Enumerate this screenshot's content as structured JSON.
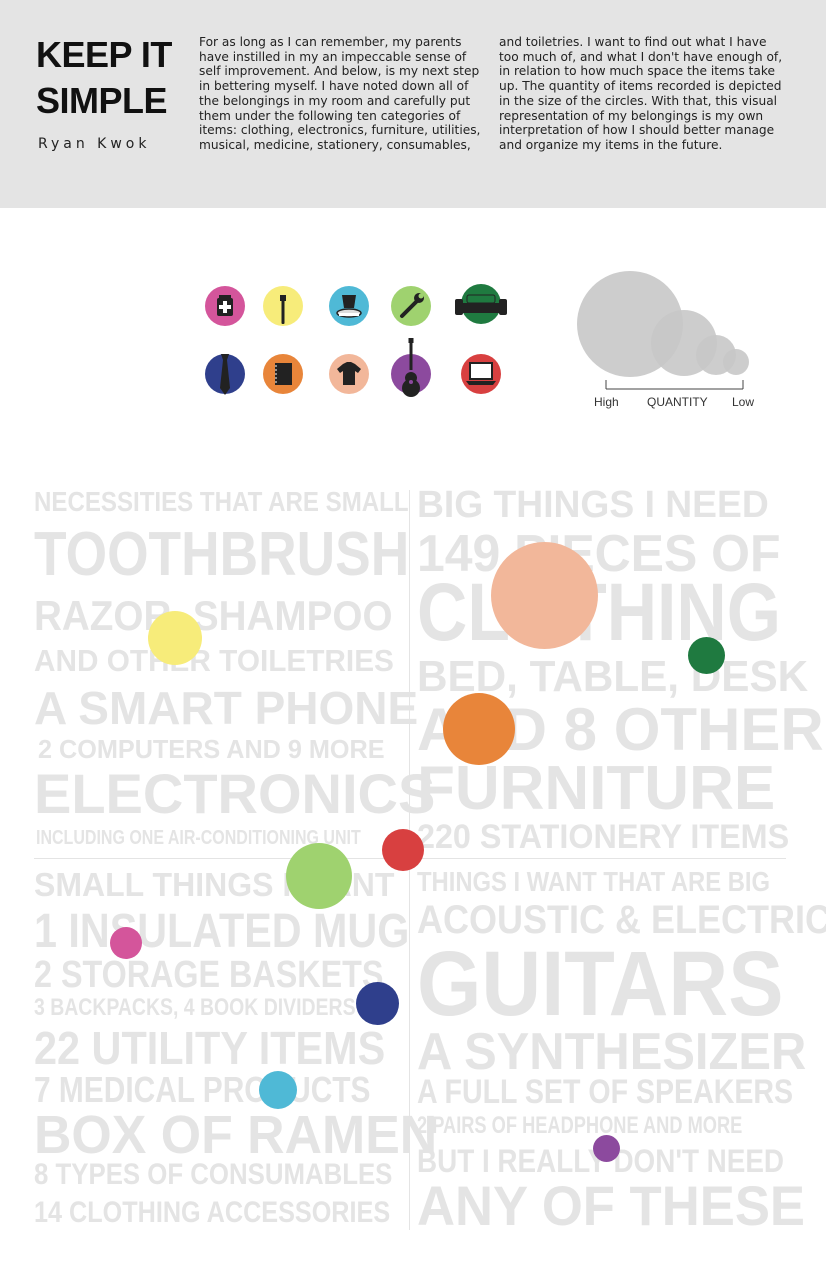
{
  "header": {
    "title_line1": "KEEP IT",
    "title_line2": "SIMPLE",
    "author": "Ryan Kwok",
    "intro_col1": "For as long as I can remember, my parents have instilled in my an impeccable sense of self improvement. And below, is my next step in bettering myself. I have noted down all of the belongings in my room and carefully put them under the following ten categories of items: clothing, electronics, furniture, utilities, musical, medicine, stationery, consumables,",
    "intro_col2": "and toiletries. I want to find out what I have too much of, and what I don't have enough of, in relation to how much space the items take up. The quantity of items recorded is depicted in the size of the circles. With that, this visual representation of my belongings is my own interpretation of how I should better manage and organize my items in the future."
  },
  "icons": [
    {
      "name": "medicine-icon",
      "color": "#d4559b"
    },
    {
      "name": "toothbrush-icon",
      "color": "#f7ec7a"
    },
    {
      "name": "consumables-icon",
      "color": "#4fb9d6"
    },
    {
      "name": "wrench-icon",
      "color": "#9fd26f"
    },
    {
      "name": "sofa-icon",
      "color": "#1f7a40"
    },
    {
      "name": "tie-icon",
      "color": "#2f3f8c"
    },
    {
      "name": "notebook-icon",
      "color": "#e8853a"
    },
    {
      "name": "shirt-icon",
      "color": "#f2b79a"
    },
    {
      "name": "guitar-icon",
      "color": "#8c4a9e"
    },
    {
      "name": "laptop-icon",
      "color": "#d84040"
    }
  ],
  "legend": {
    "high": "High",
    "quantity": "QUANTITY",
    "low": "Low",
    "circle_color": "#c8c8c8"
  },
  "wall": {
    "left": [
      "NECESSITIES THAT ARE SMALL",
      "TOOTHBRUSH",
      "RAZOR, SHAMPOO",
      "AND OTHER TOILETRIES",
      "A SMART PHONE",
      "2 COMPUTERS AND 9 MORE",
      "ELECTRONICS",
      "INCLUDING ONE AIR-CONDITIONING UNIT",
      "SMALL THINGS I WANT",
      "1 INSULATED MUG",
      "2 STORAGE BASKETS",
      "3 BACKPACKS, 4 BOOK DIVIDERS",
      "22 UTILITY ITEMS",
      "7 MEDICAL PRODUCTS",
      "BOX OF RAMEN",
      "8 TYPES OF CONSUMABLES",
      "14 CLOTHING ACCESSORIES"
    ],
    "right": [
      "BIG THINGS I NEED",
      "149 PIECES OF",
      "CLOTHING",
      "BED, TABLE, DESK",
      "AND 8 OTHER",
      "FURNITURE",
      "220 STATIONERY ITEMS",
      "THINGS I WANT THAT ARE BIG",
      "ACOUSTIC & ELECTRIC",
      "GUITARS",
      "A SYNTHESIZER",
      "A FULL SET OF SPEAKERS",
      "2 PAIRS OF HEADPHONE AND MORE",
      "BUT I REALLY DON'T NEED",
      "ANY OF THESE"
    ]
  },
  "dots": [
    {
      "name": "toiletries-dot",
      "color": "#f7ec7a"
    },
    {
      "name": "clothing-dot",
      "color": "#f2b79a"
    },
    {
      "name": "furniture-dot",
      "color": "#1f7a40"
    },
    {
      "name": "stationery-dot",
      "color": "#e8853a"
    },
    {
      "name": "electronics-dot",
      "color": "#d84040"
    },
    {
      "name": "utility-dot",
      "color": "#9fd26f"
    },
    {
      "name": "medicine-dot",
      "color": "#d4559b"
    },
    {
      "name": "clothing-accessories-dot",
      "color": "#2f3f8c"
    },
    {
      "name": "consumables-dot",
      "color": "#4fb9d6"
    },
    {
      "name": "musical-dot",
      "color": "#8c4a9e"
    }
  ]
}
